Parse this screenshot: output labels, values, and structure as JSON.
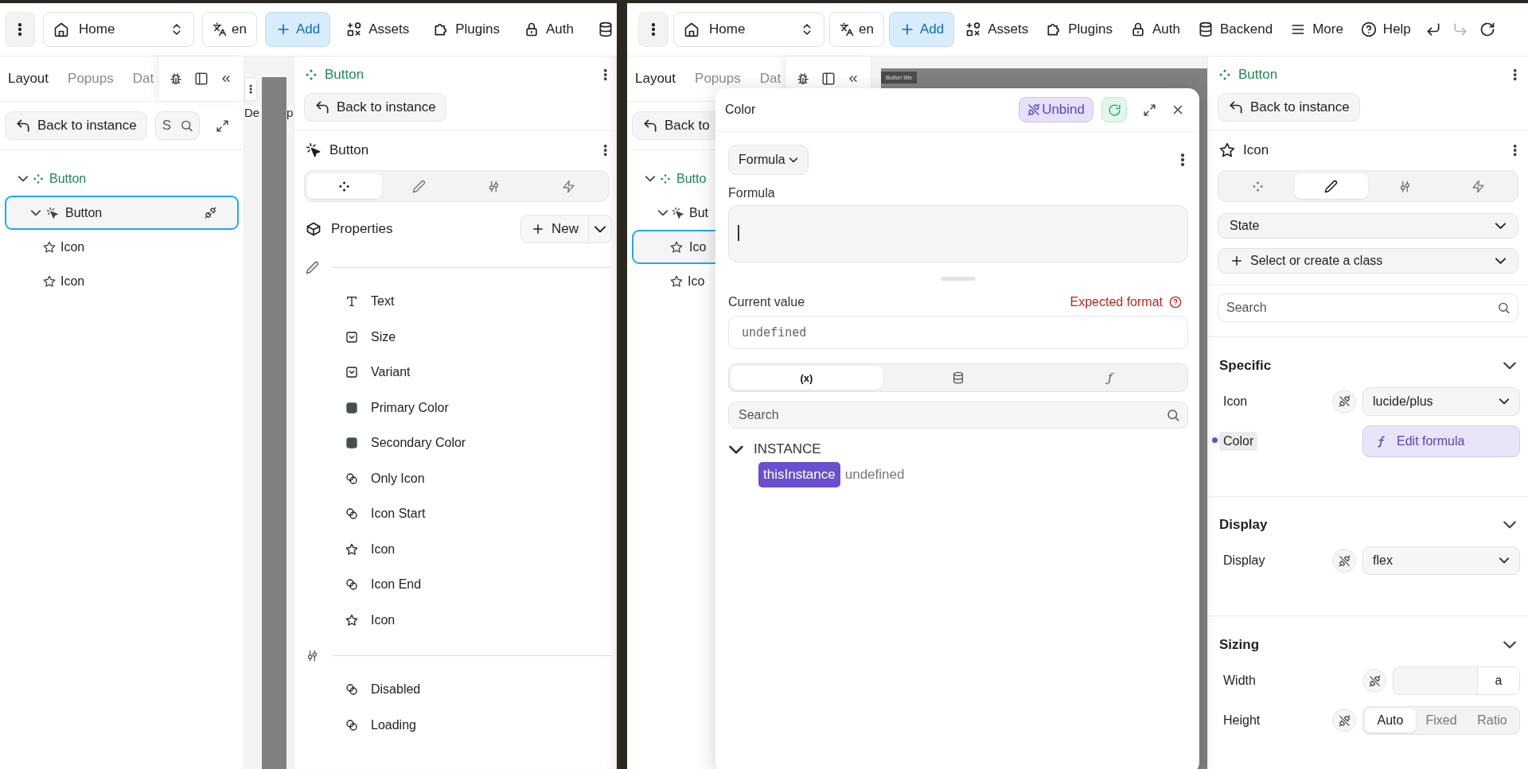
{
  "left_window": {
    "toolbar": {
      "items": [
        {
          "kind": "menu"
        },
        {
          "kind": "page-select",
          "label": "Home"
        },
        {
          "kind": "language",
          "label": "en"
        },
        {
          "kind": "add",
          "label": "Add"
        },
        {
          "kind": "assets",
          "label": "Assets"
        },
        {
          "kind": "plugins",
          "label": "Plugins"
        },
        {
          "kind": "auth",
          "label": "Auth"
        },
        {
          "kind": "backend"
        }
      ]
    },
    "sidebar": {
      "tabs": [
        {
          "label": "Layout",
          "selected": true
        },
        {
          "label": "Popups",
          "selected": false
        },
        {
          "label": "Dat",
          "selected": false
        }
      ],
      "back_button": "Back to instance",
      "search": {
        "placeholder": "S"
      },
      "tree": [
        {
          "label": "Button",
          "kind": "component",
          "selected": false,
          "linked": false,
          "expanded": true,
          "children": [
            {
              "label": "Button",
              "kind": "button",
              "selected": true,
              "linked": true,
              "expanded": true,
              "children": [
                {
                  "label": "Icon",
                  "kind": "icon",
                  "selected": false,
                  "linked": false
                },
                {
                  "label": "Icon",
                  "kind": "icon",
                  "selected": false,
                  "linked": false
                }
              ]
            }
          ]
        }
      ]
    },
    "canvas": {
      "labels": [
        "De",
        "p"
      ]
    },
    "inspector": {
      "header": "Button",
      "back_button": "Back to instance",
      "element": {
        "label": "Button",
        "kind": "button"
      },
      "tabs": [
        {
          "kind": "layout",
          "selected": true
        },
        {
          "kind": "style",
          "selected": false
        },
        {
          "kind": "settings",
          "selected": false
        },
        {
          "kind": "workflow",
          "selected": false
        }
      ],
      "properties": {
        "title": "Properties",
        "new_button": "New",
        "groups": [
          {
            "kind": "content",
            "items": [
              {
                "label": "Text",
                "kind": "text"
              },
              {
                "label": "Size",
                "kind": "select"
              },
              {
                "label": "Variant",
                "kind": "select"
              },
              {
                "label": "Primary Color",
                "kind": "color"
              },
              {
                "label": "Secondary Color",
                "kind": "color"
              },
              {
                "label": "Only Icon",
                "kind": "toggle"
              },
              {
                "label": "Icon Start",
                "kind": "toggle"
              },
              {
                "label": "Icon",
                "kind": "icon"
              },
              {
                "label": "Icon End",
                "kind": "toggle"
              },
              {
                "label": "Icon",
                "kind": "icon"
              }
            ]
          },
          {
            "kind": "settings",
            "items": [
              {
                "label": "Disabled",
                "kind": "toggle"
              },
              {
                "label": "Loading",
                "kind": "toggle"
              }
            ]
          }
        ]
      }
    }
  },
  "right_window": {
    "toolbar": {
      "items": [
        {
          "kind": "menu"
        },
        {
          "kind": "page-select",
          "label": "Home"
        },
        {
          "kind": "language",
          "label": "en"
        },
        {
          "kind": "add",
          "label": "Add"
        },
        {
          "kind": "assets",
          "label": "Assets"
        },
        {
          "kind": "plugins",
          "label": "Plugins"
        },
        {
          "kind": "auth",
          "label": "Auth"
        },
        {
          "kind": "backend",
          "label": "Backend"
        },
        {
          "kind": "more",
          "label": "More"
        },
        {
          "kind": "help",
          "label": "Help"
        },
        {
          "kind": "undo",
          "disabled": false
        },
        {
          "kind": "redo",
          "disabled": true
        },
        {
          "kind": "refresh"
        }
      ]
    },
    "sidebar": {
      "tabs": [
        {
          "label": "Layout",
          "selected": true
        },
        {
          "label": "Popups",
          "selected": false
        },
        {
          "label": "Dat",
          "selected": false
        }
      ],
      "back_button": "Back to",
      "tree": [
        {
          "label": "Butto",
          "kind": "component",
          "selected": false,
          "expanded": true,
          "children": [
            {
              "label": "But",
              "kind": "button",
              "selected": false,
              "expanded": true,
              "children": [
                {
                  "label": "Ico",
                  "kind": "icon",
                  "selected": true
                },
                {
                  "label": "Ico",
                  "kind": "icon",
                  "selected": false
                }
              ]
            }
          ]
        }
      ]
    },
    "canvas": {
      "label": "Button title"
    },
    "modal": {
      "title": "Color",
      "unbind_button": "Unbind",
      "mode_select": "Formula",
      "formula_label": "Formula",
      "current_label": "Current value",
      "expected_format": "Expected format",
      "current_value": "undefined",
      "tabs": [
        {
          "kind": "variables",
          "label": "(x)",
          "selected": true
        },
        {
          "kind": "data",
          "selected": false
        },
        {
          "kind": "functions",
          "label": "ƒ",
          "selected": false
        }
      ],
      "search": {
        "placeholder": "Search"
      },
      "groups": [
        {
          "label": "INSTANCE",
          "expanded": true,
          "children": [
            {
              "name": "thisInstance",
              "value": "undefined"
            }
          ]
        }
      ]
    },
    "inspector": {
      "header": "Button",
      "back_button": "Back to instance",
      "element": {
        "label": "Icon",
        "kind": "icon"
      },
      "tabs": [
        {
          "kind": "layout",
          "selected": false
        },
        {
          "kind": "style",
          "selected": true
        },
        {
          "kind": "settings",
          "selected": false
        },
        {
          "kind": "workflow",
          "selected": false
        }
      ],
      "state_select": "State",
      "class_select": "Select or create a class",
      "search": {
        "placeholder": "Search"
      },
      "sections": [
        {
          "title": "Specific",
          "rows": [
            {
              "label": "Icon",
              "kind": "select",
              "value": "lucide/plus",
              "bound": false
            },
            {
              "label": "Color",
              "kind": "formula",
              "value": "Edit formula",
              "bound": true
            }
          ]
        },
        {
          "title": "Display",
          "rows": [
            {
              "label": "Display",
              "kind": "select",
              "value": "flex",
              "bound": false
            }
          ]
        },
        {
          "title": "Sizing",
          "rows": [
            {
              "label": "Width",
              "kind": "unit",
              "unit": "a",
              "bound": false
            },
            {
              "label": "Height",
              "kind": "segmented",
              "bound": false,
              "options": [
                {
                  "label": "Auto",
                  "selected": true
                },
                {
                  "label": "Fixed",
                  "selected": false
                },
                {
                  "label": "Ratio",
                  "selected": false
                }
              ]
            }
          ]
        }
      ]
    }
  }
}
